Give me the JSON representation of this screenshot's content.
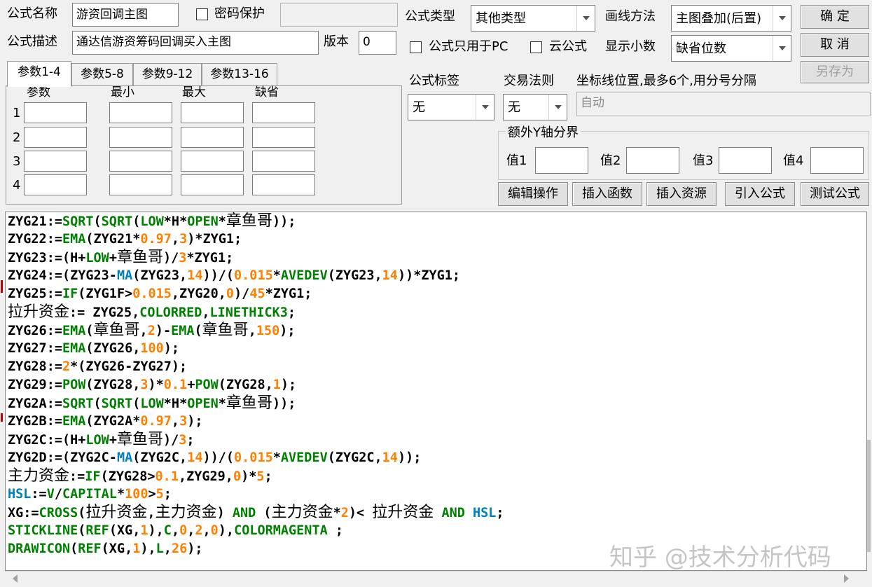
{
  "header": {
    "formula_name_label": "公式名称",
    "formula_name_value": "游资回调主图",
    "password_label": "密码保护",
    "password_checked": false,
    "password_value": "",
    "formula_desc_label": "公式描述",
    "formula_desc_value": "通达信游资筹码回调买入主图",
    "version_label": "版本",
    "version_value": "0"
  },
  "options": {
    "formula_type_label": "公式类型",
    "formula_type_value": "其他类型",
    "draw_method_label": "画线方法",
    "draw_method_value": "主图叠加(后置)",
    "pc_only_label": "公式只用于PC",
    "pc_only_checked": false,
    "cloud_label": "云公式",
    "cloud_checked": false,
    "decimals_label": "显示小数",
    "decimals_value": "缺省位数",
    "tag_label": "公式标签",
    "tag_value": "无",
    "trade_rule_label": "交易法则",
    "trade_rule_value": "无",
    "axis_label": "坐标线位置,最多6个,用分号分隔",
    "axis_value": "自动",
    "extra_y_label": "额外Y轴分界",
    "extra_y_values": [
      {
        "label": "值1",
        "value": ""
      },
      {
        "label": "值2",
        "value": ""
      },
      {
        "label": "值3",
        "value": ""
      },
      {
        "label": "值4",
        "value": ""
      }
    ]
  },
  "buttons": {
    "ok": "确  定",
    "cancel": "取  消",
    "save_as": "另存为",
    "edit_ops": "编辑操作",
    "insert_func": "插入函数",
    "insert_res": "插入资源",
    "import_formula": "引入公式",
    "test_formula": "测试公式"
  },
  "params": {
    "tabs": [
      "参数1-4",
      "参数5-8",
      "参数9-12",
      "参数13-16"
    ],
    "active_tab": 0,
    "columns": [
      "参数",
      "最小",
      "最大",
      "缺省"
    ],
    "rows": [
      "1",
      "2",
      "3",
      "4"
    ]
  },
  "colors": {
    "keyword": "#008000",
    "number": "#ff8000",
    "blue_func": "#0080c0",
    "default": "#000000"
  },
  "code_lines": [
    [
      [
        "t",
        "ZYG21:="
      ],
      [
        "k",
        "SQRT"
      ],
      [
        "t",
        "("
      ],
      [
        "k",
        "SQRT"
      ],
      [
        "t",
        "("
      ],
      [
        "k",
        "LOW"
      ],
      [
        "t",
        "*H*"
      ],
      [
        "k",
        "OPEN"
      ],
      [
        "t",
        "*"
      ],
      [
        "c",
        "章鱼哥"
      ],
      [
        "t",
        "));"
      ]
    ],
    [
      [
        "t",
        "ZYG22:="
      ],
      [
        "k",
        "EMA"
      ],
      [
        "t",
        "(ZYG21*"
      ],
      [
        "n",
        "0.97"
      ],
      [
        "t",
        ","
      ],
      [
        "n",
        "3"
      ],
      [
        "t",
        ")*ZYG1;"
      ]
    ],
    [
      [
        "t",
        "ZYG23:=(H+"
      ],
      [
        "k",
        "LOW"
      ],
      [
        "t",
        "+"
      ],
      [
        "c",
        "章鱼哥"
      ],
      [
        "t",
        ")/"
      ],
      [
        "n",
        "3"
      ],
      [
        "t",
        "*ZYG1;"
      ]
    ],
    [
      [
        "t",
        "ZYG24:=(ZYG23-"
      ],
      [
        "b",
        "MA"
      ],
      [
        "t",
        "(ZYG23,"
      ],
      [
        "n",
        "14"
      ],
      [
        "t",
        "))/("
      ],
      [
        "n",
        "0.015"
      ],
      [
        "t",
        "*"
      ],
      [
        "k",
        "AVEDEV"
      ],
      [
        "t",
        "(ZYG23,"
      ],
      [
        "n",
        "14"
      ],
      [
        "t",
        "))*ZYG1;"
      ]
    ],
    [
      [
        "t",
        "ZYG25:="
      ],
      [
        "k",
        "IF"
      ],
      [
        "t",
        "(ZYG1F>"
      ],
      [
        "n",
        "0.015"
      ],
      [
        "t",
        ",ZYG20,"
      ],
      [
        "n",
        "0"
      ],
      [
        "t",
        ")/"
      ],
      [
        "n",
        "45"
      ],
      [
        "t",
        "*ZYG1;"
      ]
    ],
    [
      [
        "c",
        "拉升资金"
      ],
      [
        "t",
        ":= ZYG25,"
      ],
      [
        "k",
        "COLORRED"
      ],
      [
        "t",
        ","
      ],
      [
        "k",
        "LINETHICK3"
      ],
      [
        "t",
        ";"
      ]
    ],
    [
      [
        "t",
        "ZYG26:="
      ],
      [
        "k",
        "EMA"
      ],
      [
        "t",
        "("
      ],
      [
        "c",
        "章鱼哥"
      ],
      [
        "t",
        ","
      ],
      [
        "n",
        "2"
      ],
      [
        "t",
        ")-"
      ],
      [
        "k",
        "EMA"
      ],
      [
        "t",
        "("
      ],
      [
        "c",
        "章鱼哥"
      ],
      [
        "t",
        ","
      ],
      [
        "n",
        "150"
      ],
      [
        "t",
        ");"
      ]
    ],
    [
      [
        "t",
        "ZYG27:="
      ],
      [
        "k",
        "EMA"
      ],
      [
        "t",
        "(ZYG26,"
      ],
      [
        "n",
        "100"
      ],
      [
        "t",
        ");"
      ]
    ],
    [
      [
        "t",
        "ZYG28:="
      ],
      [
        "n",
        "2"
      ],
      [
        "t",
        "*(ZYG26-ZYG27);"
      ]
    ],
    [
      [
        "t",
        "ZYG29:="
      ],
      [
        "k",
        "POW"
      ],
      [
        "t",
        "(ZYG28,"
      ],
      [
        "n",
        "3"
      ],
      [
        "t",
        ")*"
      ],
      [
        "n",
        "0.1"
      ],
      [
        "t",
        "+"
      ],
      [
        "k",
        "POW"
      ],
      [
        "t",
        "(ZYG28,"
      ],
      [
        "n",
        "1"
      ],
      [
        "t",
        ");"
      ]
    ],
    [
      [
        "t",
        "ZYG2A:="
      ],
      [
        "k",
        "SQRT"
      ],
      [
        "t",
        "("
      ],
      [
        "k",
        "SQRT"
      ],
      [
        "t",
        "("
      ],
      [
        "k",
        "LOW"
      ],
      [
        "t",
        "*H*"
      ],
      [
        "k",
        "OPEN"
      ],
      [
        "t",
        "*"
      ],
      [
        "c",
        "章鱼哥"
      ],
      [
        "t",
        "));"
      ]
    ],
    [
      [
        "t",
        "ZYG2B:="
      ],
      [
        "k",
        "EMA"
      ],
      [
        "t",
        "(ZYG2A*"
      ],
      [
        "n",
        "0.97"
      ],
      [
        "t",
        ","
      ],
      [
        "n",
        "3"
      ],
      [
        "t",
        ");"
      ]
    ],
    [
      [
        "t",
        "ZYG2C:=(H+"
      ],
      [
        "k",
        "LOW"
      ],
      [
        "t",
        "+"
      ],
      [
        "c",
        "章鱼哥"
      ],
      [
        "t",
        ")/"
      ],
      [
        "n",
        "3"
      ],
      [
        "t",
        ";"
      ]
    ],
    [
      [
        "t",
        "ZYG2D:=(ZYG2C-"
      ],
      [
        "b",
        "MA"
      ],
      [
        "t",
        "(ZYG2C,"
      ],
      [
        "n",
        "14"
      ],
      [
        "t",
        "))/("
      ],
      [
        "n",
        "0.015"
      ],
      [
        "t",
        "*"
      ],
      [
        "k",
        "AVEDEV"
      ],
      [
        "t",
        "(ZYG2C,"
      ],
      [
        "n",
        "14"
      ],
      [
        "t",
        "));"
      ]
    ],
    [
      [
        "c",
        "主力资金"
      ],
      [
        "t",
        ":="
      ],
      [
        "k",
        "IF"
      ],
      [
        "t",
        "(ZYG28>"
      ],
      [
        "n",
        "0.1"
      ],
      [
        "t",
        ",ZYG29,"
      ],
      [
        "n",
        "0"
      ],
      [
        "t",
        ")*"
      ],
      [
        "n",
        "5"
      ],
      [
        "t",
        ";"
      ]
    ],
    [
      [
        "b",
        "HSL"
      ],
      [
        "t",
        ":="
      ],
      [
        "k",
        "V"
      ],
      [
        "t",
        "/"
      ],
      [
        "k",
        "CAPITAL"
      ],
      [
        "t",
        "*"
      ],
      [
        "n",
        "100"
      ],
      [
        "t",
        ">"
      ],
      [
        "n",
        "5"
      ],
      [
        "t",
        ";"
      ]
    ],
    [
      [
        "t",
        "XG:="
      ],
      [
        "k",
        "CROSS"
      ],
      [
        "t",
        "("
      ],
      [
        "c",
        "拉升资金"
      ],
      [
        "t",
        ","
      ],
      [
        "c",
        "主力资金"
      ],
      [
        "t",
        ") "
      ],
      [
        "k",
        "AND"
      ],
      [
        "t",
        " ("
      ],
      [
        "c",
        "主力资金"
      ],
      [
        "t",
        "*"
      ],
      [
        "n",
        "2"
      ],
      [
        "t",
        ")< "
      ],
      [
        "c",
        "拉升资金"
      ],
      [
        "t",
        " "
      ],
      [
        "k",
        "AND"
      ],
      [
        "t",
        " "
      ],
      [
        "b",
        "HSL"
      ],
      [
        "t",
        ";"
      ]
    ],
    [
      [
        "k",
        "STICKLINE"
      ],
      [
        "t",
        "("
      ],
      [
        "k",
        "REF"
      ],
      [
        "t",
        "(XG,"
      ],
      [
        "n",
        "1"
      ],
      [
        "t",
        "),"
      ],
      [
        "k",
        "C"
      ],
      [
        "t",
        ","
      ],
      [
        "n",
        "0"
      ],
      [
        "t",
        ","
      ],
      [
        "n",
        "2"
      ],
      [
        "t",
        ","
      ],
      [
        "n",
        "0"
      ],
      [
        "t",
        "),"
      ],
      [
        "k",
        "COLORMAGENTA"
      ],
      [
        "t",
        " ;"
      ]
    ],
    [
      [
        "k",
        "DRAWICON"
      ],
      [
        "t",
        "("
      ],
      [
        "k",
        "REF"
      ],
      [
        "t",
        "(XG,"
      ],
      [
        "n",
        "1"
      ],
      [
        "t",
        "),"
      ],
      [
        "k",
        "L"
      ],
      [
        "t",
        ","
      ],
      [
        "n",
        "26"
      ],
      [
        "t",
        ");"
      ]
    ]
  ],
  "watermark": "知乎 @技术分析代码"
}
